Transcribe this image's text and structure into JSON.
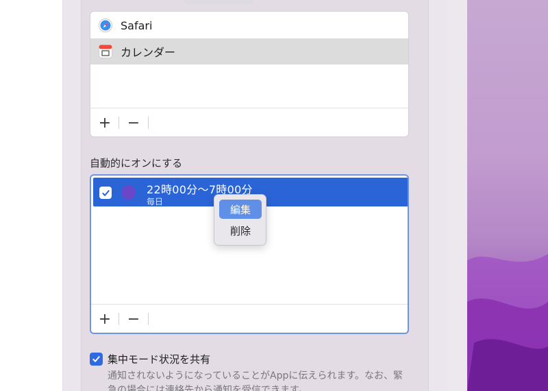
{
  "top_list": {
    "items": [
      {
        "label": "Safari",
        "icon": "safari-icon"
      },
      {
        "label": "カレンダー",
        "icon": "calendar-icon"
      }
    ],
    "add_label": "+",
    "remove_label": "−"
  },
  "auto_on": {
    "title": "自動的にオンにする",
    "schedule": {
      "time": "22時00分〜7時00分",
      "days": "毎日"
    },
    "add_label": "+",
    "remove_label": "−"
  },
  "context_menu": {
    "edit": "編集",
    "delete": "削除"
  },
  "share": {
    "label": "集中モード状況を共有",
    "description": "通知されないようになっていることがAppに伝えられます。なお、緊急の場合には連絡先から通知を受信できます。"
  },
  "colors": {
    "accent": "#2a64d6",
    "menu_highlight": "#5f8fe6"
  }
}
